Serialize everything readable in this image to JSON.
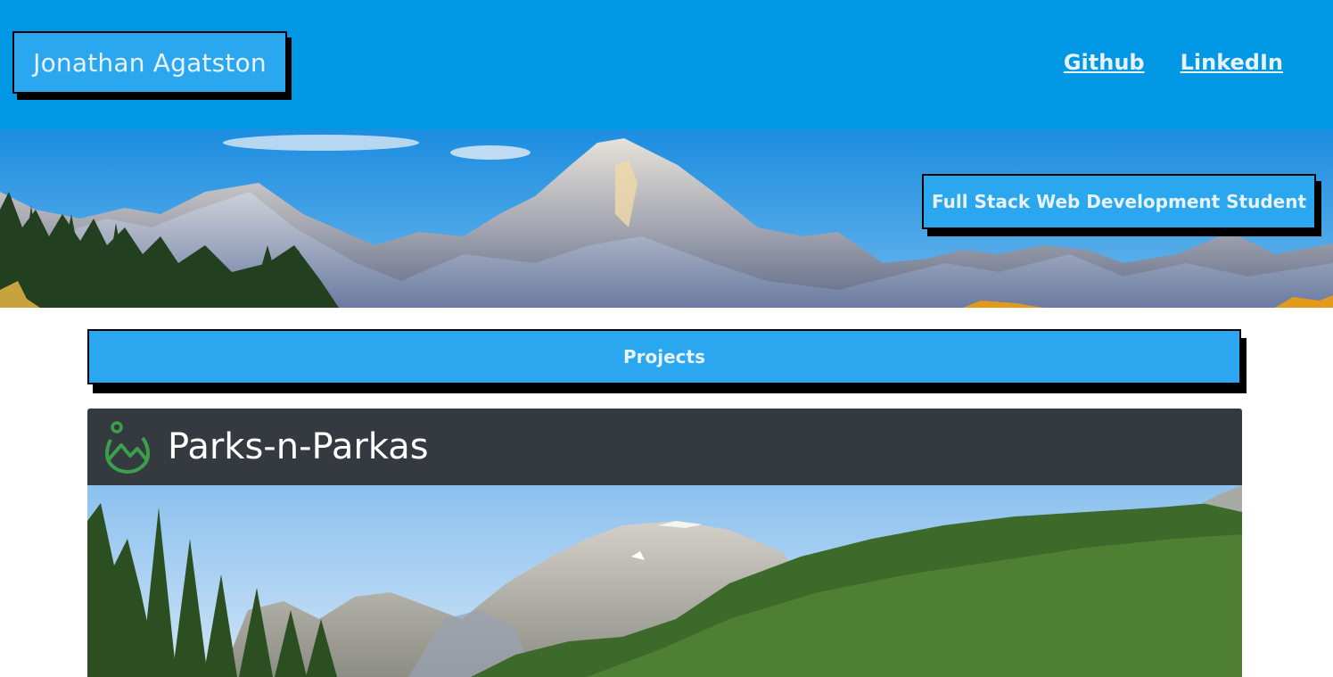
{
  "header": {
    "name": "Jonathan Agatston",
    "links": [
      {
        "label": "Github"
      },
      {
        "label": "LinkedIn"
      }
    ]
  },
  "banner": {
    "tagline": "Full Stack Web Development Student"
  },
  "projects": {
    "heading": "Projects",
    "cards": [
      {
        "title": "Parks-n-Parkas"
      }
    ]
  },
  "colors": {
    "header_bg": "#0098e4",
    "box_bg": "#2aa7ee",
    "card_header_bg": "#353940",
    "logo_green": "#3aa14a"
  }
}
